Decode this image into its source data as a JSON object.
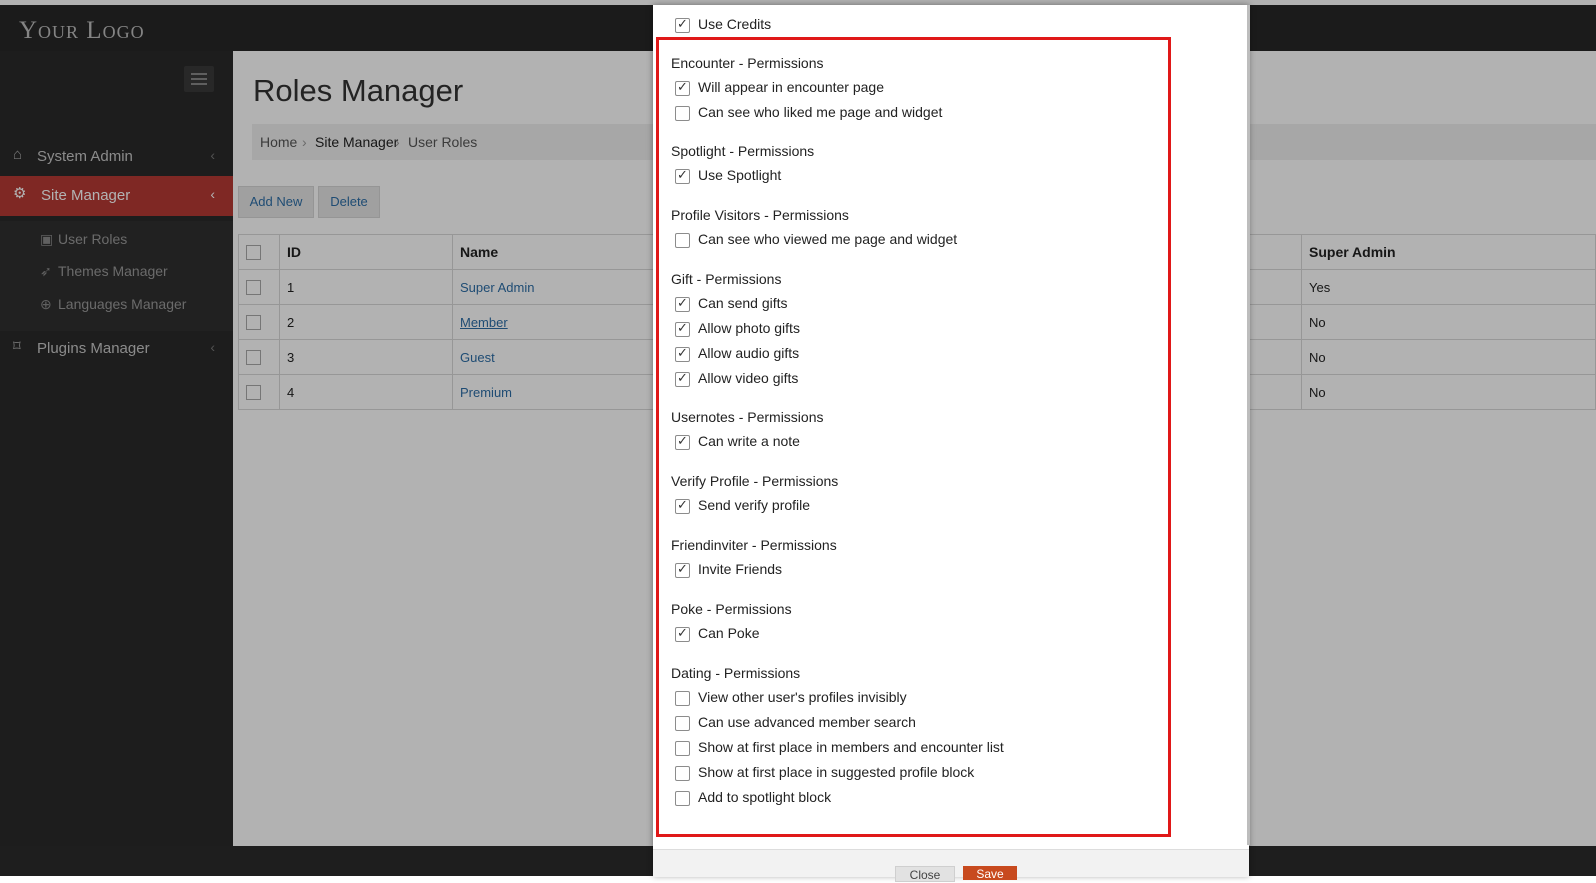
{
  "app": {
    "logo": "Your Logo"
  },
  "sidebar": {
    "items": [
      {
        "label": "System Admin",
        "icon": "home-icon",
        "active": false
      },
      {
        "label": "Site Manager",
        "icon": "gears-icon",
        "active": true
      },
      {
        "label": "Plugins Manager",
        "icon": "tag-icon",
        "active": false
      }
    ],
    "subitems": [
      {
        "label": "User Roles",
        "icon": "briefcase-icon"
      },
      {
        "label": "Themes Manager",
        "icon": "rocket-icon"
      },
      {
        "label": "Languages Manager",
        "icon": "globe-icon"
      }
    ]
  },
  "main": {
    "title": "Roles Manager",
    "breadcrumb": [
      "Home",
      "Site Manager",
      "User Roles"
    ],
    "buttons": {
      "add_new": "Add New",
      "delete": "Delete"
    },
    "table": {
      "headers": [
        "ID",
        "Name",
        "Super Admin"
      ],
      "rows": [
        {
          "id": "1",
          "name": "Super Admin",
          "super_admin": "Yes"
        },
        {
          "id": "2",
          "name": "Member",
          "super_admin": "No"
        },
        {
          "id": "3",
          "name": "Guest",
          "super_admin": "No"
        },
        {
          "id": "4",
          "name": "Premium",
          "super_admin": "No"
        }
      ]
    }
  },
  "modal": {
    "top_item": {
      "label": "Use Credits",
      "checked": true
    },
    "sections": [
      {
        "title": "Encounter - Permissions",
        "items": [
          {
            "label": "Will appear in encounter page",
            "checked": true
          },
          {
            "label": "Can see who liked me page and widget",
            "checked": false
          }
        ]
      },
      {
        "title": "Spotlight - Permissions",
        "items": [
          {
            "label": "Use Spotlight",
            "checked": true
          }
        ]
      },
      {
        "title": "Profile Visitors - Permissions",
        "items": [
          {
            "label": "Can see who viewed me page and widget",
            "checked": false
          }
        ]
      },
      {
        "title": "Gift - Permissions",
        "items": [
          {
            "label": "Can send gifts",
            "checked": true
          },
          {
            "label": "Allow photo gifts",
            "checked": true
          },
          {
            "label": "Allow audio gifts",
            "checked": true
          },
          {
            "label": "Allow video gifts",
            "checked": true
          }
        ]
      },
      {
        "title": "Usernotes - Permissions",
        "items": [
          {
            "label": "Can write a note",
            "checked": true
          }
        ]
      },
      {
        "title": "Verify Profile - Permissions",
        "items": [
          {
            "label": "Send verify profile",
            "checked": true
          }
        ]
      },
      {
        "title": "Friendinviter - Permissions",
        "items": [
          {
            "label": "Invite Friends",
            "checked": true
          }
        ]
      },
      {
        "title": "Poke - Permissions",
        "items": [
          {
            "label": "Can Poke",
            "checked": true
          }
        ]
      },
      {
        "title": "Dating - Permissions",
        "items": [
          {
            "label": "View other user's profiles invisibly",
            "checked": false
          },
          {
            "label": "Can use advanced member search",
            "checked": false
          },
          {
            "label": "Show at first place in members and encounter list",
            "checked": false
          },
          {
            "label": "Show at first place in suggested profile block",
            "checked": false
          },
          {
            "label": "Add to spotlight block",
            "checked": false
          }
        ]
      }
    ],
    "footer": {
      "close_label": "Close",
      "save_label": "Save"
    },
    "highlight_color": "#e01818"
  },
  "colors": {
    "accent": "#b63a34",
    "link": "#2d6ea6",
    "save_button": "#c84a1e"
  }
}
